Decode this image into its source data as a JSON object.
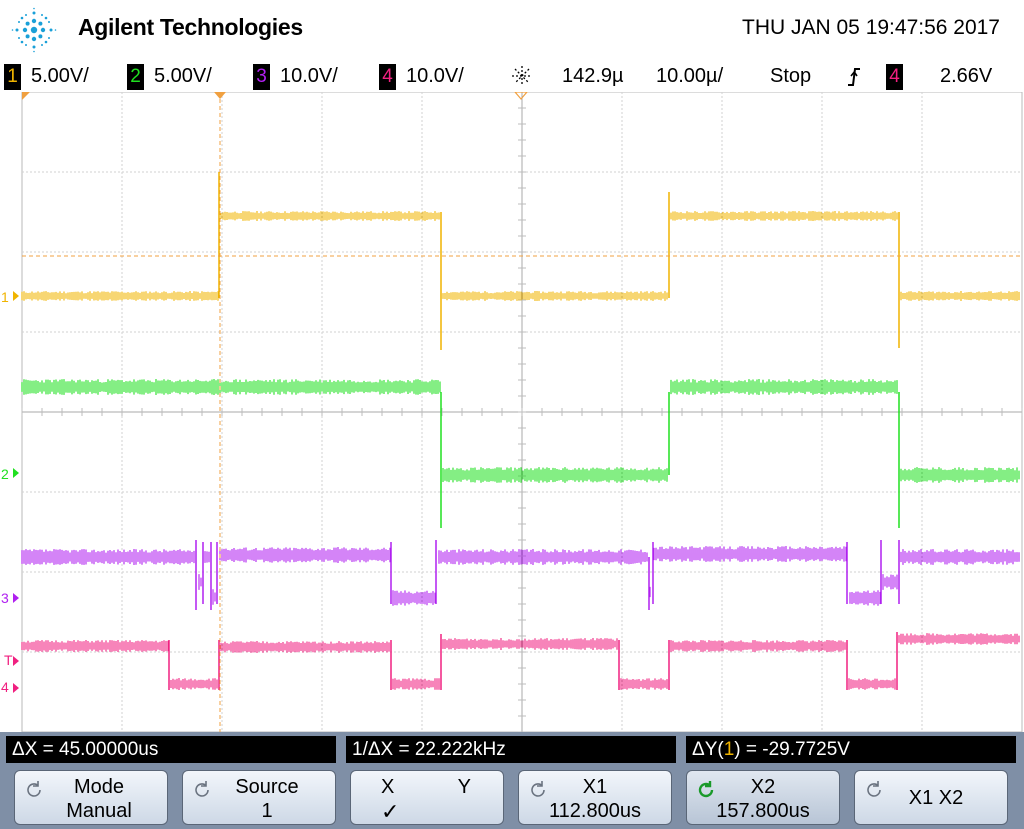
{
  "header": {
    "brand": "Agilent Technologies",
    "datetime": "THU JAN 05 19:47:56 2017"
  },
  "channels": [
    {
      "num": "1",
      "scale": "5.00V/",
      "color": "#f0b400"
    },
    {
      "num": "2",
      "scale": "5.00V/",
      "color": "#20e020"
    },
    {
      "num": "3",
      "scale": "10.0V/",
      "color": "#b020f0"
    },
    {
      "num": "4",
      "scale": "10.0V/",
      "color": "#f02080"
    }
  ],
  "timebase": {
    "delay": "142.9µ",
    "scale": "10.00µ/",
    "run_state": "Stop",
    "trigger_slope_icon": "rising-edge-icon",
    "trigger_source": "4",
    "trigger_level": "2.66V"
  },
  "markers": {
    "ch1": "1",
    "ch2": "2",
    "ch3": "3",
    "ch4": "4",
    "trigger": "T"
  },
  "measurements": {
    "delta_x": "ΔX = 45.00000us",
    "inv_delta_x": "1/ΔX = 22.222kHz",
    "delta_y_prefix": "ΔY(",
    "delta_y_channel": "1",
    "delta_y_suffix": ") = -29.7725V"
  },
  "softkeys": {
    "mode_label": "Mode",
    "mode_value": "Manual",
    "source_label": "Source",
    "source_value": "1",
    "x_label": "X",
    "y_label": "Y",
    "x_check": "✓",
    "x1_label": "X1",
    "x1_value": "112.800us",
    "x2_label": "X2",
    "x2_value": "157.800us",
    "x1x2_label": "X1 X2"
  },
  "colors": {
    "ch1": "#f0b400",
    "ch2": "#20e020",
    "ch3": "#b020f0",
    "ch4": "#f02080",
    "cursor": "#f0a040",
    "bezel": "#7f8fa6"
  }
}
